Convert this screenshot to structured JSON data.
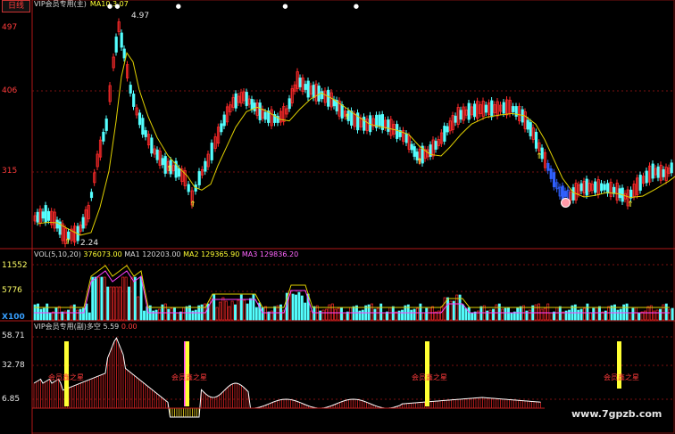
{
  "header": {
    "period_tab": "日线",
    "main_formula_label": "VIP会员专用(主)",
    "ma10_label": "MA10",
    "ma10_value": "3.07"
  },
  "price_axis": {
    "ticks": [
      "497",
      "406",
      "315"
    ],
    "high_label": "4.97",
    "low_label": "2.24"
  },
  "volume_panel": {
    "legend_name": "VOL(5,10,20)",
    "vol_value": "376073.00",
    "ma1_label": "MA1",
    "ma1_value": "120203.00",
    "ma2_label": "MA2",
    "ma2_value": "129365.90",
    "ma3_label": "MA3",
    "ma3_value": "129836.20",
    "ticks": [
      "11552",
      "5776"
    ],
    "unit": "X100"
  },
  "indicator_panel": {
    "legend_name": "VIP会员专用(副)",
    "legend_label": "多空",
    "value1": "5.59",
    "value2": "0.00",
    "ticks": [
      "58.71",
      "32.78",
      "6.85"
    ],
    "signal_label": "会员鑫之星"
  },
  "watermark": "www.7gpzb.com",
  "colors": {
    "up": "#ff2a2a",
    "down": "#54ffff",
    "ma_line": "#e0d000",
    "ma3_line": "#ff40ff",
    "grid": "#7a1010",
    "signal_bar": "#ffff33"
  },
  "chart_data": [
    {
      "type": "candlestick",
      "title": "",
      "ylim": [
        2.0,
        5.05
      ],
      "annotations": [
        "4.97",
        "2.24"
      ],
      "ma_series": [
        {
          "name": "MA10",
          "last": 3.07
        }
      ]
    },
    {
      "type": "bar",
      "title": "VOL(5,10,20)",
      "ylim": [
        0,
        12500
      ],
      "series": [
        {
          "name": "MA1",
          "last": 120203.0
        },
        {
          "name": "MA2",
          "last": 129365.9
        },
        {
          "name": "MA3",
          "last": 129836.2
        }
      ]
    },
    {
      "type": "bar",
      "title": "多空",
      "ylim": [
        -2,
        62
      ],
      "values_note": "",
      "signal_positions_label": "会员鑫之星"
    }
  ]
}
